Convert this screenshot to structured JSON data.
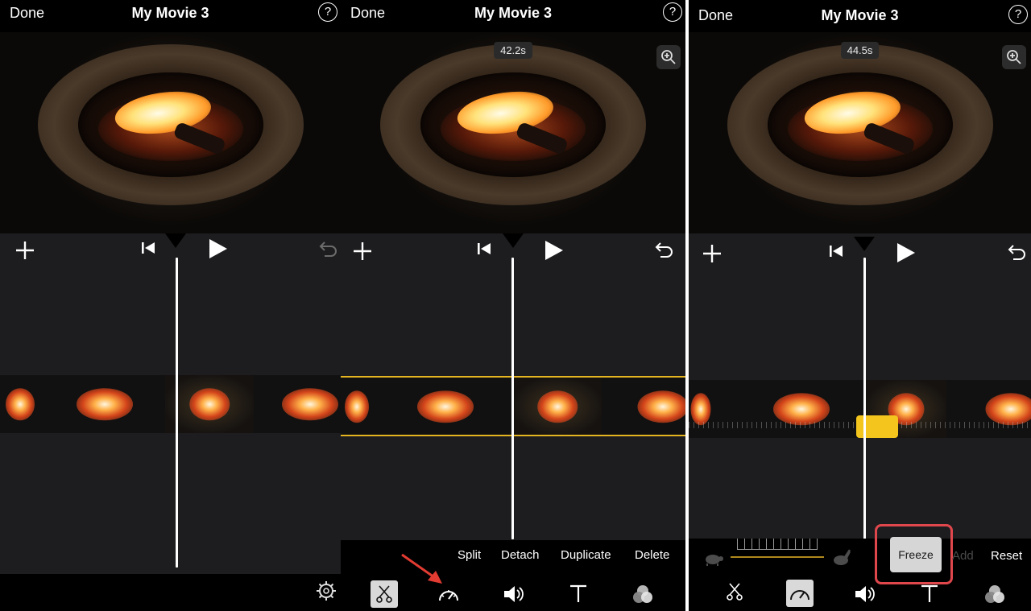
{
  "panels": [
    {
      "done_label": "Done",
      "title": "My Movie 3",
      "help_label": "?",
      "time_badge": null
    },
    {
      "done_label": "Done",
      "title": "My Movie 3",
      "help_label": "?",
      "time_badge": "42.2s",
      "actions": [
        "Split",
        "Detach",
        "Duplicate",
        "Delete"
      ]
    },
    {
      "done_label": "Done",
      "title": "My Movie 3",
      "help_label": "?",
      "time_badge": "44.5s",
      "freeze_label": "Freeze",
      "add_label": "Add",
      "reset_label": "Reset"
    }
  ],
  "icons": {
    "add": "plus-icon",
    "rewind": "skip-to-start-icon",
    "play": "play-icon",
    "undo": "undo-icon",
    "help": "question-circle-icon",
    "zoom": "zoom-icon",
    "settings": "gear-icon",
    "scissors": "scissors-icon",
    "speed": "speedometer-icon",
    "volume": "speaker-icon",
    "titles": "text-icon",
    "filters": "filters-icon",
    "turtle": "turtle-icon",
    "rabbit": "rabbit-icon"
  },
  "colors": {
    "selection_yellow": "#e4b521",
    "handle_yellow": "#f3c51d",
    "highlight_red": "#e0474c",
    "timeline_bg": "#1d1d1f"
  }
}
